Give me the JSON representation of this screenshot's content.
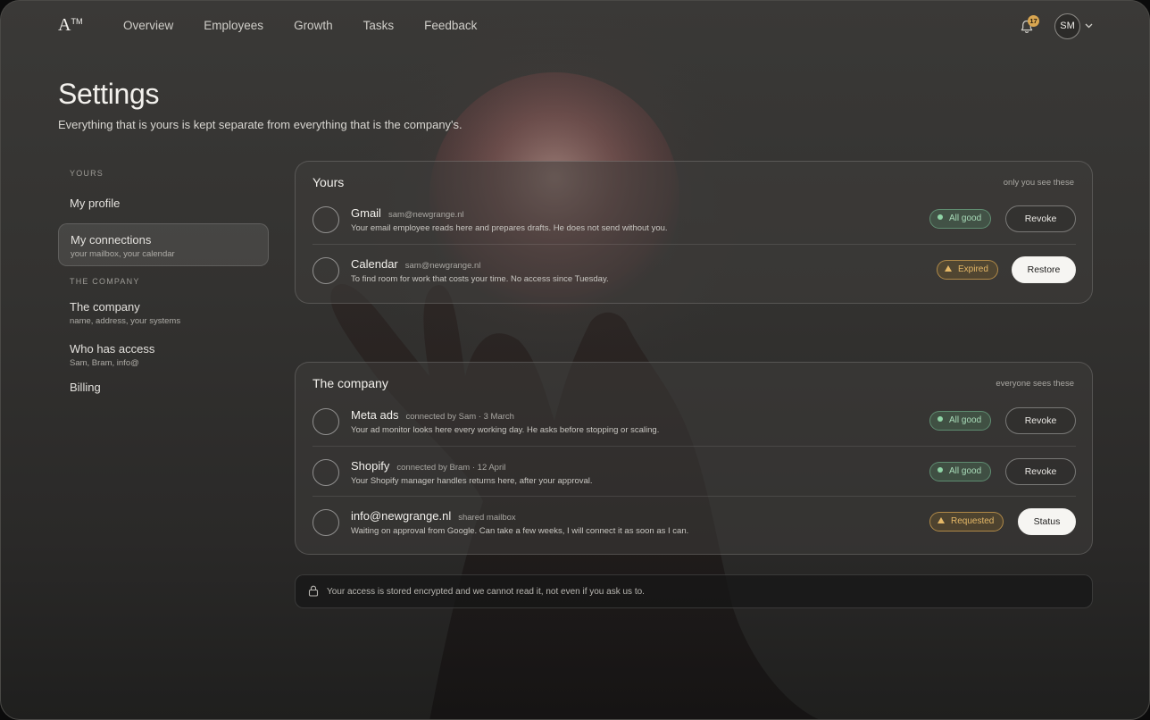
{
  "app": {
    "logo": "A",
    "logo_mark": "TM"
  },
  "nav": {
    "items": [
      "Overview",
      "Employees",
      "Growth",
      "Tasks",
      "Feedback"
    ]
  },
  "header": {
    "notification_count": "17",
    "avatar_initials": "SM",
    "icons": {
      "bell": "bell-icon",
      "chevron": "chevron-down-icon"
    }
  },
  "page": {
    "title": "Settings",
    "subtitle": "Everything that is yours is kept separate from everything that is the company's."
  },
  "sidebar": {
    "yours_heading": "YOURS",
    "items": [
      {
        "label": "My profile",
        "sub": ""
      },
      {
        "label": "My connections",
        "sub": "your mailbox, your calendar"
      }
    ],
    "company_heading": "THE COMPANY",
    "company_items": [
      {
        "label": "The company",
        "sub": "name, address, your systems"
      },
      {
        "label": "Who has access",
        "sub": "Sam, Bram, info@"
      },
      {
        "label": "Billing",
        "sub": ""
      }
    ]
  },
  "yours": {
    "title": "Yours",
    "note": "only you see these",
    "rows": [
      {
        "name": "Gmail",
        "meta": "sam@newgrange.nl",
        "desc": "Your email employee reads here and prepares drafts. He does not send without you.",
        "status": "All good",
        "status_kind": "ok",
        "action": "Revoke",
        "action_kind": "ghost"
      },
      {
        "name": "Calendar",
        "meta": "sam@newgrange.nl",
        "desc": "To find room for work that costs your time. No access since Tuesday.",
        "status": "Expired",
        "status_kind": "warn",
        "action": "Restore",
        "action_kind": "solid"
      }
    ]
  },
  "company": {
    "title": "The company",
    "note": "everyone sees these",
    "rows": [
      {
        "name": "Meta ads",
        "meta": "connected by Sam · 3 March",
        "desc": "Your ad monitor looks here every working day. He asks before stopping or scaling.",
        "status": "All good",
        "status_kind": "ok",
        "action": "Revoke",
        "action_kind": "ghost"
      },
      {
        "name": "Shopify",
        "meta": "connected by Bram · 12 April",
        "desc": "Your Shopify manager handles returns here, after your approval.",
        "status": "All good",
        "status_kind": "ok",
        "action": "Revoke",
        "action_kind": "ghost"
      },
      {
        "name": "info@newgrange.nl",
        "meta": "shared mailbox",
        "desc": "Waiting on approval from Google. Can take a few weeks, I will connect it as soon as I can.",
        "status": "Requested",
        "status_kind": "warn",
        "action": "Status",
        "action_kind": "solid"
      }
    ]
  },
  "notice": {
    "icon": "lock-icon",
    "text": "Your access is stored encrypted and we cannot read it, not even if you ask us to."
  }
}
